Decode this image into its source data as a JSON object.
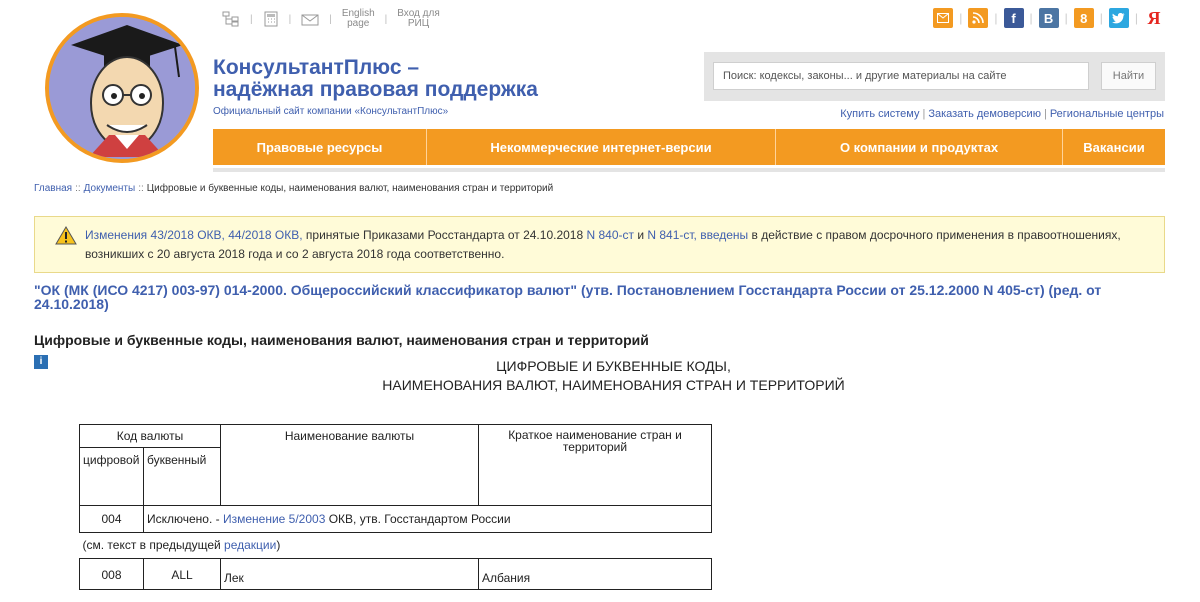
{
  "topbar": {
    "english": [
      "English",
      "page"
    ],
    "rits": [
      "Вход для",
      "РИЦ"
    ]
  },
  "social_letters": {
    "fb": "f",
    "vk": "В",
    "ok": "8",
    "ya": "Я"
  },
  "colors": {
    "brand_orange": "#f39a21",
    "brand_blue": "#3f5fae",
    "notice_bg": "#fffbd8"
  },
  "brand": {
    "line1": "КонсультантПлюс –",
    "line2": "надёжная правовая поддержка",
    "sub": "Официальный сайт компании «КонсультантПлюс»"
  },
  "search": {
    "placeholder": "Поиск: кодексы, законы... и другие материалы на сайте",
    "button": "Найти"
  },
  "links": [
    "Купить систему",
    "Заказать демоверсию",
    "Региональные центры"
  ],
  "nav": [
    "Правовые ресурсы",
    "Некоммерческие интернет-версии",
    "О компании и продуктах",
    "Вакансии"
  ],
  "breadcrumb": {
    "home": "Главная",
    "docs": "Документы",
    "current": "Цифровые и буквенные коды, наименования валют, наименования стран и территорий"
  },
  "notice": {
    "p1": "Изменения 43/2018 ОКВ, 44/2018 ОКВ,",
    "p2": " принятые Приказами Росстандарта от 24.10.2018 ",
    "p3": "N 840-ст",
    "p4": " и ",
    "p5": "N 841-ст, введены",
    "p6": " в действие с правом досрочного применения в правоотношениях, возникших с 20 августа 2018 года и со 2 августа 2018 года соответственно."
  },
  "doc_title": "\"ОК (МК (ИСО 4217) 003-97) 014-2000. Общероссийский классификатор валют\" (утв. Постановлением Госстандарта России от 25.12.2000 N 405-ст) (ред. от 24.10.2018)",
  "section_title": "Цифровые и буквенные коды, наименования валют, наименования стран и территорий",
  "info_icon": "i",
  "center_heading": [
    "ЦИФРОВЫЕ И БУКВЕННЫЕ КОДЫ,",
    "НАИМЕНОВАНИЯ ВАЛЮТ, НАИМЕНОВАНИЯ СТРАН И ТЕРРИТОРИЙ"
  ],
  "table": {
    "h_code": "Код валюты",
    "h_name": "Наименование валюты",
    "h_short": "Краткое наименование стран и территорий",
    "h_digit": "цифровой",
    "h_letter": "буквенный",
    "row1_code": "004",
    "row1_text1": "Исключено. - ",
    "row1_link": "Изменение 5/2003",
    "row1_text2": " ОКВ, утв. Госстандартом России",
    "row1_note1": "(см. текст в предыдущей ",
    "row1_note_link": "редакции",
    "row1_note2": ")",
    "row2": {
      "digit": "008",
      "letter": "ALL",
      "name": "Лек",
      "country": "Албания"
    }
  }
}
